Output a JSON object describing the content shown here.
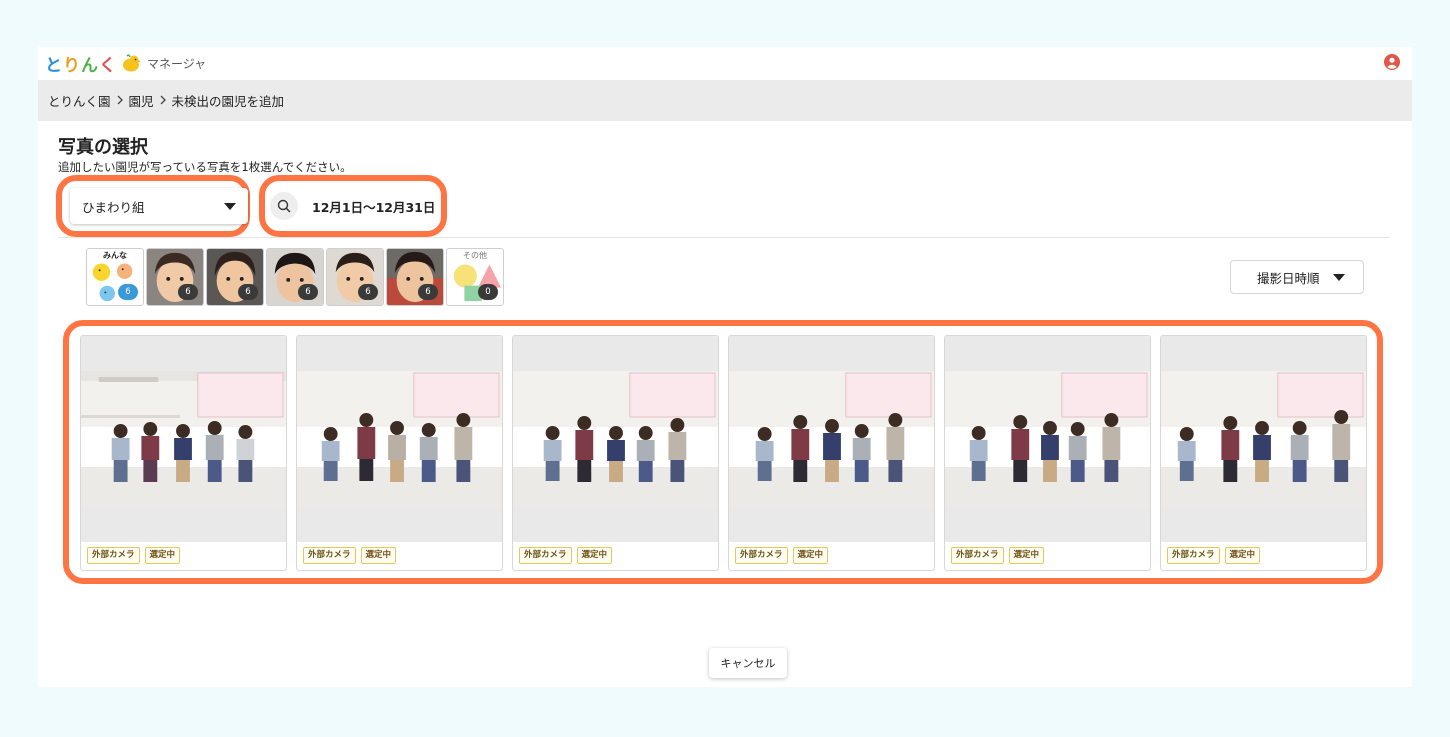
{
  "app": {
    "logo_main": [
      "と",
      "り",
      "ん",
      "く"
    ],
    "logo_sub": "マネージャ"
  },
  "breadcrumb": [
    "とりんく園",
    "園児",
    "未検出の園児を追加"
  ],
  "page": {
    "title": "写真の選択",
    "subtitle": "追加したい園児が写っている写真を1枚選んでください。"
  },
  "filters": {
    "class_value": "ひまわり組",
    "date_range": "12月1日〜12月31日",
    "sort_value": "撮影日時順"
  },
  "face_thumbs": [
    {
      "label": "みんな",
      "count": "6",
      "kind": "all"
    },
    {
      "label": "",
      "count": "6",
      "kind": "face"
    },
    {
      "label": "",
      "count": "6",
      "kind": "face"
    },
    {
      "label": "",
      "count": "6",
      "kind": "face"
    },
    {
      "label": "",
      "count": "6",
      "kind": "face"
    },
    {
      "label": "",
      "count": "6",
      "kind": "face"
    },
    {
      "label": "その他",
      "count": "0",
      "kind": "other"
    }
  ],
  "photos": [
    {
      "tags": [
        "外部カメラ",
        "選定中"
      ]
    },
    {
      "tags": [
        "外部カメラ",
        "選定中"
      ]
    },
    {
      "tags": [
        "外部カメラ",
        "選定中"
      ]
    },
    {
      "tags": [
        "外部カメラ",
        "選定中"
      ]
    },
    {
      "tags": [
        "外部カメラ",
        "選定中"
      ]
    },
    {
      "tags": [
        "外部カメラ",
        "選定中"
      ]
    }
  ],
  "footer": {
    "cancel_label": "キャンセル"
  },
  "colors": {
    "highlight": "#ff7443",
    "page_bg": "#f0fbfd",
    "count_blue": "#3a9ad9"
  }
}
